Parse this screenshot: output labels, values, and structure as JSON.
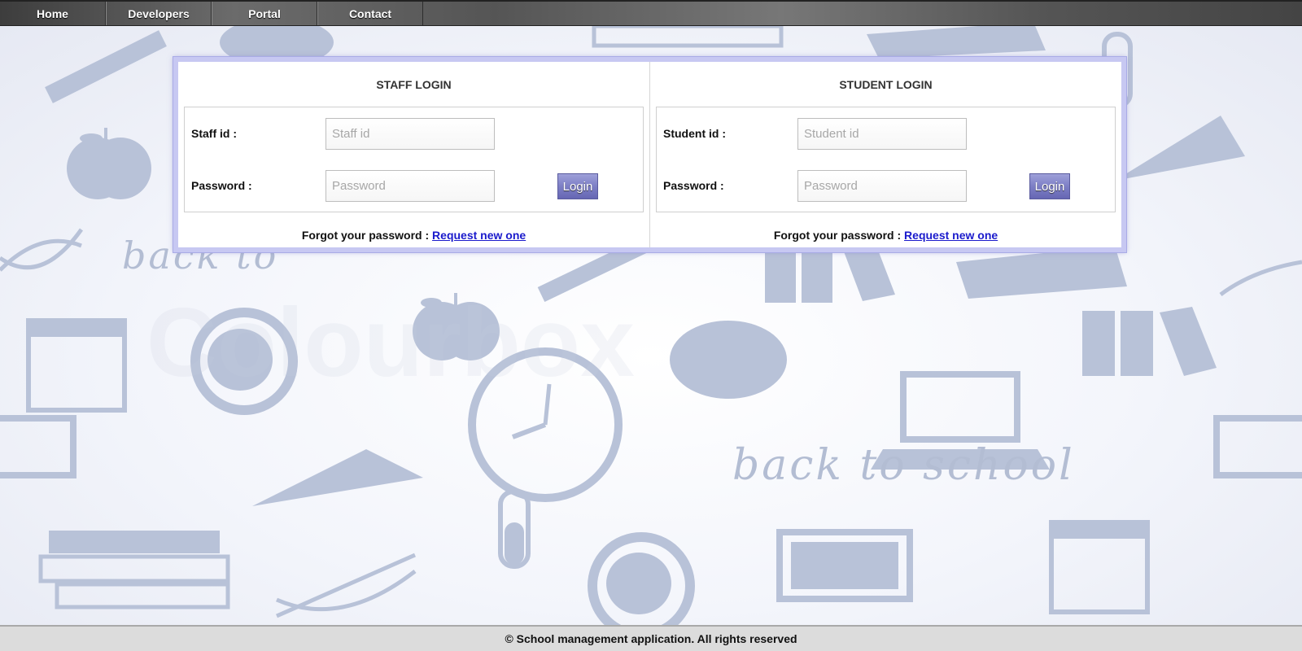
{
  "nav": {
    "items": [
      {
        "label": "Home"
      },
      {
        "label": "Developers"
      },
      {
        "label": "Portal"
      },
      {
        "label": "Contact"
      }
    ]
  },
  "background": {
    "tagline": "back to school",
    "tagline_partial": "back to"
  },
  "staff_login": {
    "title": "STAFF LOGIN",
    "id_label": "Staff id :",
    "id_placeholder": "Staff id",
    "password_label": "Password :",
    "password_placeholder": "Password",
    "button": "Login",
    "forgot_text": "Forgot your password : ",
    "forgot_link": "Request new one"
  },
  "student_login": {
    "title": "STUDENT LOGIN",
    "id_label": "Student id :",
    "id_placeholder": "Student id",
    "password_label": "Password :",
    "password_placeholder": "Password",
    "button": "Login",
    "forgot_text": "Forgot your password : ",
    "forgot_link": "Request new one"
  },
  "footer": {
    "text": "© School management application. All rights reserved"
  },
  "colors": {
    "nav_bg": "#555555",
    "panel_border": "#c7c8f2",
    "button": "#7d7fc6",
    "link": "#1a1acc",
    "icon": "#b8c2d8"
  }
}
